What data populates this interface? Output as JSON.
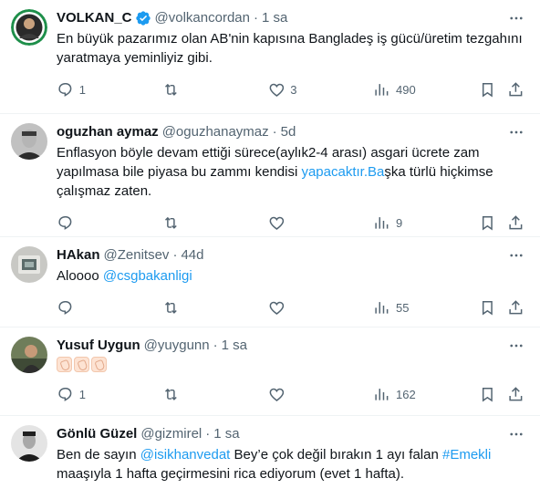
{
  "tweets": [
    {
      "name": "VOLKAN_C",
      "verified": true,
      "handle": "@volkancordan",
      "time": "1 sa",
      "text_lines": [
        "En büyük pazarımız olan AB'nin kapısına Bangladeş iş gücü/üretim tezgahını",
        "yaratmaya yeminliyiz gibi."
      ],
      "replies": "1",
      "retweets": "",
      "likes": "3",
      "views": "490"
    },
    {
      "name": "oguzhan aymaz",
      "verified": false,
      "handle": "@oguzhanaymaz",
      "time": "5d",
      "text_line1": "Enflasyon böyle devam ettiği sürece(aylık2-4 arası) asgari ücrete zam",
      "text_line2": "yapılmasa bile piyasa bu zammı kendisi",
      "text_link": "yapacaktır.Ba",
      "text_line2_rest": "şka türlü hiçkimse",
      "text_line3": "çalışmaz zaten.",
      "replies": "",
      "retweets": "",
      "likes": "",
      "views": "9"
    },
    {
      "name": "HAkan",
      "verified": false,
      "handle": "@Zenitsev",
      "time": "44d",
      "text_prefix": "Aloooo",
      "text_mention": "@csgbakanligi",
      "replies": "",
      "retweets": "",
      "likes": "",
      "views": "55"
    },
    {
      "name": "Yusuf Uygun",
      "verified": false,
      "handle": "@yuygunn",
      "time": "1 sa",
      "emoji": "clapping-hands-x3",
      "replies": "1",
      "retweets": "",
      "likes": "",
      "views": "162"
    },
    {
      "name": "Gönlü Güzel",
      "verified": false,
      "handle": "@gizmirel",
      "time": "1 sa",
      "text_part1": "Ben de sayın",
      "text_mention": "@isikhanvedat",
      "text_part2": "Bey’e çok değil bırakın 1 ayı falan",
      "text_hashtag": "#Emekli",
      "text_line2": "maaşıyla 1 hafta geçirmesini rica ediyorum (evet 1 hafta)."
    }
  ],
  "separator": "·",
  "colors": {
    "text": "#0f1419",
    "secondary": "#536471",
    "link": "#1d9bf0",
    "divider": "#eff3f4",
    "verified_badge": "#1d9bf0"
  },
  "icons": [
    "reply-icon",
    "retweet-icon",
    "like-icon",
    "views-icon",
    "bookmark-icon",
    "share-icon",
    "more-icon",
    "verified-badge-icon"
  ]
}
